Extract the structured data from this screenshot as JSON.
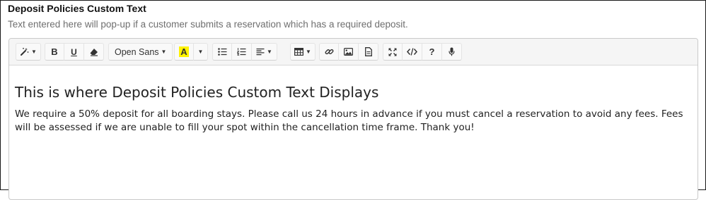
{
  "field": {
    "title": "Deposit Policies Custom Text",
    "help": "Text entered here will pop-up if a customer submits a reservation which has a required deposit."
  },
  "toolbar": {
    "style_icon": "magic-wand-icon",
    "bold_icon": "bold-icon",
    "underline_icon": "underline-icon",
    "clear_format_icon": "eraser-icon",
    "font_name": "Open Sans",
    "font_color_label": "A",
    "highlight_color": "#fff200",
    "unordered_list_icon": "bulleted-list-icon",
    "ordered_list_icon": "numbered-list-icon",
    "paragraph_icon": "align-left-icon",
    "table_icon": "table-icon",
    "link_icon": "link-icon",
    "picture_icon": "image-icon",
    "file_icon": "file-icon",
    "fullscreen_icon": "fullscreen-icon",
    "codeview_icon": "code-icon",
    "help_label": "?",
    "mic_icon": "microphone-icon"
  },
  "content": {
    "heading": "This is where Deposit Policies Custom Text Displays",
    "body": "We require a 50% deposit for all boarding stays. Please call us 24 hours in advance if you must cancel a reservation to avoid any fees. Fees will be assessed if we are unable to fill your spot within the cancellation time frame. Thank you!"
  }
}
